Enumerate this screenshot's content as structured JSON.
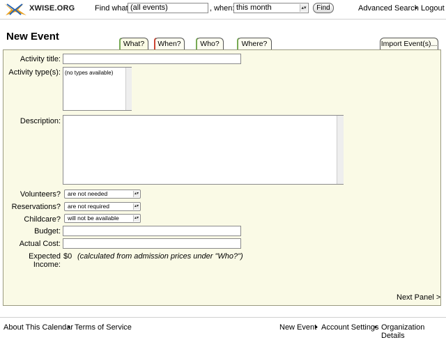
{
  "header": {
    "logo_text": "XWISE.ORG",
    "find_label": "Find what:",
    "find_value": "(all events)",
    "when_label": ", when:",
    "when_value": "this month",
    "find_button": "Find",
    "advanced_search": "Advanced Search",
    "separator": "•",
    "logout": "Logout"
  },
  "page": {
    "title": "New Event"
  },
  "tabs": {
    "what": "What?",
    "when": "When?",
    "who": "Who?",
    "where": "Where?",
    "import": "Import Event(s)..."
  },
  "form": {
    "activity_title_label": "Activity title:",
    "activity_types_label": "Activity type(s):",
    "activity_types_empty": "(no types available)",
    "description_label": "Description:",
    "volunteers_label": "Volunteers?",
    "volunteers_value": "are not needed",
    "reservations_label": "Reservations?",
    "reservations_value": "are not required",
    "childcare_label": "Childcare?",
    "childcare_value": "will not be available",
    "budget_label": "Budget:",
    "actual_cost_label": "Actual Cost:",
    "expected_income_label": "Expected Income:",
    "expected_income_value": "$0",
    "expected_income_note": "(calculated from admission prices under \"Who?\")",
    "next_panel": "Next Panel >"
  },
  "footer": {
    "about": "About This Calendar",
    "terms": "Terms of Service",
    "new_event": "New Event",
    "account_settings": "Account Settings",
    "organization_details": "Organization Details",
    "separator": "•"
  },
  "colors": {
    "panel_bg": "#fafae6",
    "logo_x_orange": "#e8a020",
    "logo_x_blue": "#2a64b0"
  },
  "icons": {
    "logo": "xwise-x-logo",
    "dropdown": "chevron-updown-icon"
  }
}
